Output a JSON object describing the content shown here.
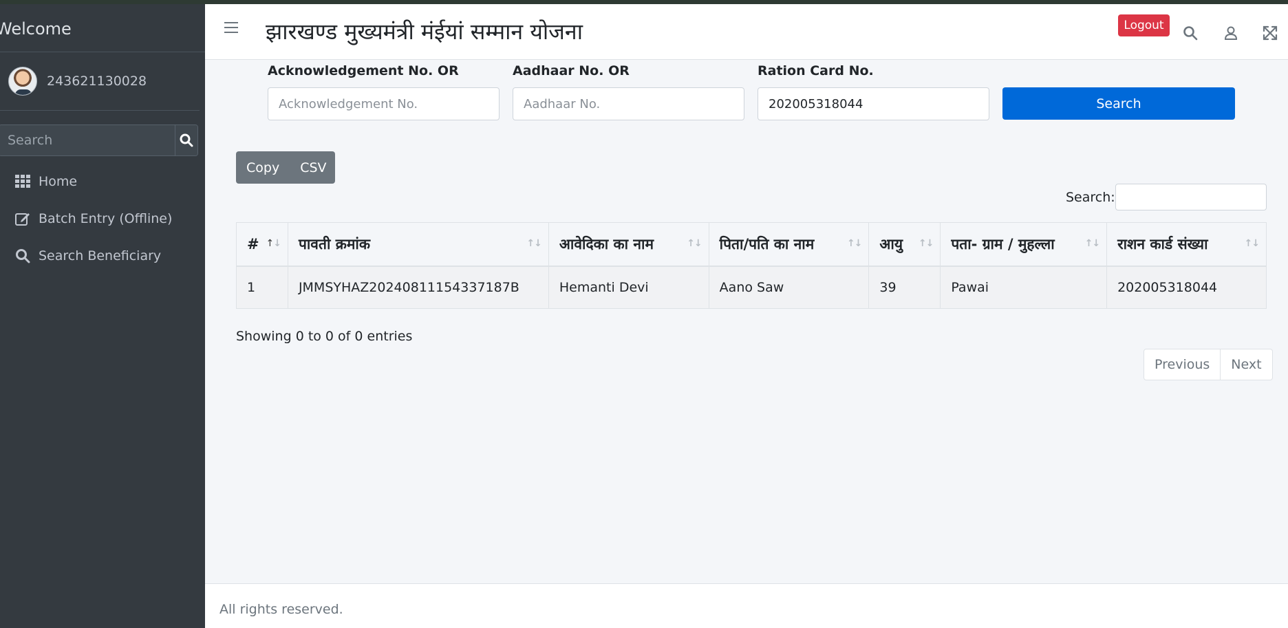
{
  "sidebar": {
    "brand": "Welcome",
    "user_name": "243621130028",
    "search_placeholder": "Search",
    "items": [
      {
        "label": "Home",
        "icon": "grid-icon"
      },
      {
        "label": "Batch Entry (Offline)",
        "icon": "edit-icon"
      },
      {
        "label": "Search Beneficiary",
        "icon": "search-icon"
      }
    ]
  },
  "header": {
    "title": "झारखण्ड मुख्यमंत्री मंईयां सम्मान योजना",
    "logout_label": "Logout"
  },
  "filters": {
    "ack_label": "Acknowledgement No. OR",
    "ack_placeholder": "Acknowledgement No.",
    "ack_value": "",
    "aadhaar_label": "Aadhaar No. OR",
    "aadhaar_placeholder": "Aadhaar No.",
    "aadhaar_value": "",
    "ration_label": "Ration Card No.",
    "ration_value": "202005318044",
    "search_button": "Search"
  },
  "export": {
    "copy": "Copy",
    "csv": "CSV"
  },
  "table": {
    "search_label": "Search:",
    "columns": [
      "#",
      "पावती क्रमांक",
      "आवेदिका का नाम",
      "पिता/पति का नाम",
      "आयु",
      "पता- ग्राम / मुहल्ला",
      "राशन कार्ड संख्या"
    ],
    "rows": [
      [
        "1",
        "JMMSYHAZ20240811154337187B",
        "Hemanti Devi",
        "Aano Saw",
        "39",
        "Pawai",
        "202005318044"
      ]
    ],
    "info": "Showing 0 to 0 of 0 entries",
    "prev": "Previous",
    "next": "Next"
  },
  "footer": {
    "text": "All rights reserved."
  },
  "colors": {
    "sidebar_bg": "#343a40",
    "primary": "#0069d9",
    "danger": "#dc3545",
    "secondary": "#6c757d"
  }
}
